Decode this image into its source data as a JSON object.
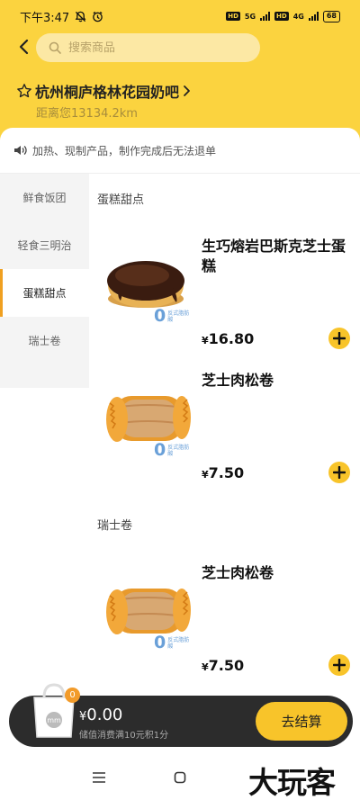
{
  "status_bar": {
    "time": "下午3:47",
    "hd1": "HD",
    "net1": "5G",
    "hd2": "HD",
    "net2": "4G",
    "battery": "68"
  },
  "search": {
    "placeholder": "搜索商品"
  },
  "store": {
    "name": "杭州桐庐格林花园奶吧",
    "distance": "距离您13134.2km"
  },
  "notice": {
    "text": "加热、现制产品，制作完成后无法退单"
  },
  "sidebar": {
    "items": [
      {
        "label": "鲜食饭团"
      },
      {
        "label": "轻食三明治"
      },
      {
        "label": "蛋糕甜点"
      },
      {
        "label": "瑞士卷"
      }
    ],
    "active_index": 2,
    "accent": "#f0a020"
  },
  "sections": [
    {
      "title": "蛋糕甜点",
      "products": [
        {
          "name": "生巧熔岩巴斯克芝士蛋糕",
          "currency": "¥",
          "price": "16.80",
          "badge_zero": "0",
          "badge_text": "反式脂肪酸"
        },
        {
          "name": "芝士肉松卷",
          "currency": "¥",
          "price": "7.50",
          "badge_zero": "0",
          "badge_text": "反式脂肪酸"
        }
      ]
    },
    {
      "title": "瑞士卷",
      "products": [
        {
          "name": "芝士肉松卷",
          "currency": "¥",
          "price": "7.50",
          "badge_zero": "0",
          "badge_text": "反式脂肪酸"
        }
      ]
    }
  ],
  "cart": {
    "count": "0",
    "currency": "¥",
    "amount": "0.00",
    "sub": "储值消费满10元积1分",
    "checkout_label": "去结算",
    "bag_label": "mm"
  },
  "watermark": "大玩客",
  "colors": {
    "brand": "#fbd33f",
    "button": "#f8c42a",
    "badge": "#f29b2a"
  }
}
